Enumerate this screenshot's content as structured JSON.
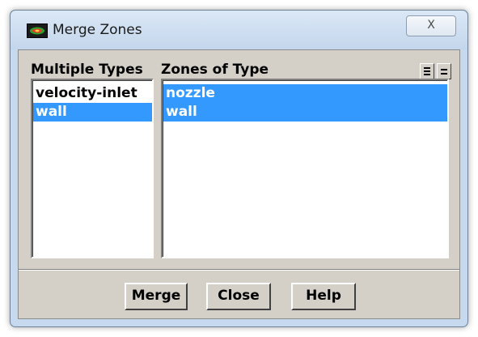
{
  "window": {
    "title": "Merge Zones",
    "close_glyph": "X",
    "icon": "fluent-app-icon"
  },
  "panels": {
    "types_header": "Multiple Types",
    "zones_header": "Zones of Type"
  },
  "types_list": {
    "items": [
      {
        "label": "velocity-inlet",
        "selected": false
      },
      {
        "label": "wall",
        "selected": true
      }
    ]
  },
  "zones_list": {
    "items": [
      {
        "label": "nozzle",
        "selected": true
      },
      {
        "label": "wall",
        "selected": true
      }
    ]
  },
  "toolbar_icons": [
    "select-all-icon",
    "deselect-all-icon"
  ],
  "buttons": {
    "merge": "Merge",
    "close": "Close",
    "help": "Help"
  },
  "colors": {
    "selection": "#3399ff",
    "dialog_bg": "#d4d0c8",
    "frame": "#c6d9ef"
  }
}
